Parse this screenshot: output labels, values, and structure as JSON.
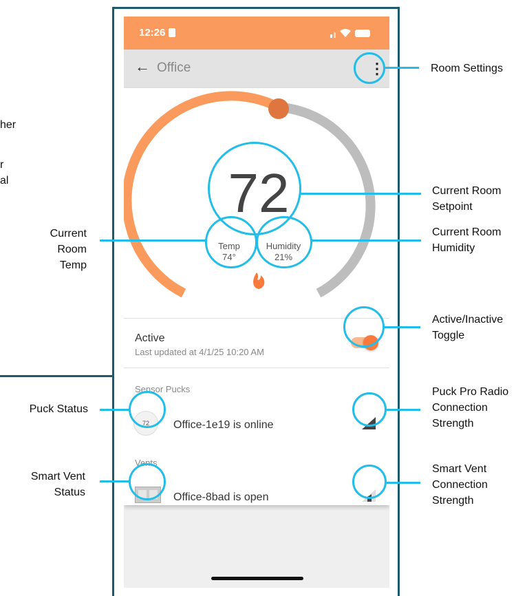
{
  "statusbar": {
    "time": "12:26"
  },
  "appbar": {
    "title": "Office"
  },
  "thermostat": {
    "setpoint": "72",
    "temp_label": "Temp",
    "temp_value": "74°",
    "humidity_label": "Humidity",
    "humidity_value": "21%"
  },
  "active": {
    "label": "Active",
    "updated": "Last updated at 4/1/25 10:20 AM",
    "on": true
  },
  "sensor_pucks": {
    "heading": "Sensor Pucks",
    "name": "Office-1e19 is online",
    "puck_value": "72"
  },
  "vents": {
    "heading": "Vents",
    "name": "Office-8bad is open"
  },
  "callouts": {
    "room_settings": "Room Settings",
    "setpoint_1": "Current Room",
    "setpoint_2": "Setpoint",
    "humidity_1": "Current Room",
    "humidity_2": "Humidity",
    "temp_1": "Current Room",
    "temp_2": "Temp",
    "toggle_1": "Active/Inactive",
    "toggle_2": "Toggle",
    "puck_status": "Puck Status",
    "puck_radio_1": "Puck Pro Radio",
    "puck_radio_2": "Connection",
    "puck_radio_3": "Strength",
    "vent_status_1": "Smart Vent",
    "vent_status_2": "Status",
    "vent_conn_1": "Smart Vent",
    "vent_conn_2": "Connection",
    "vent_conn_3": "Strength",
    "cut_1": "her",
    "cut_2": "r",
    "cut_3": "al"
  },
  "colors": {
    "accent": "#fa9a5c",
    "callout": "#22bde8",
    "frame": "#1d5a6e"
  }
}
